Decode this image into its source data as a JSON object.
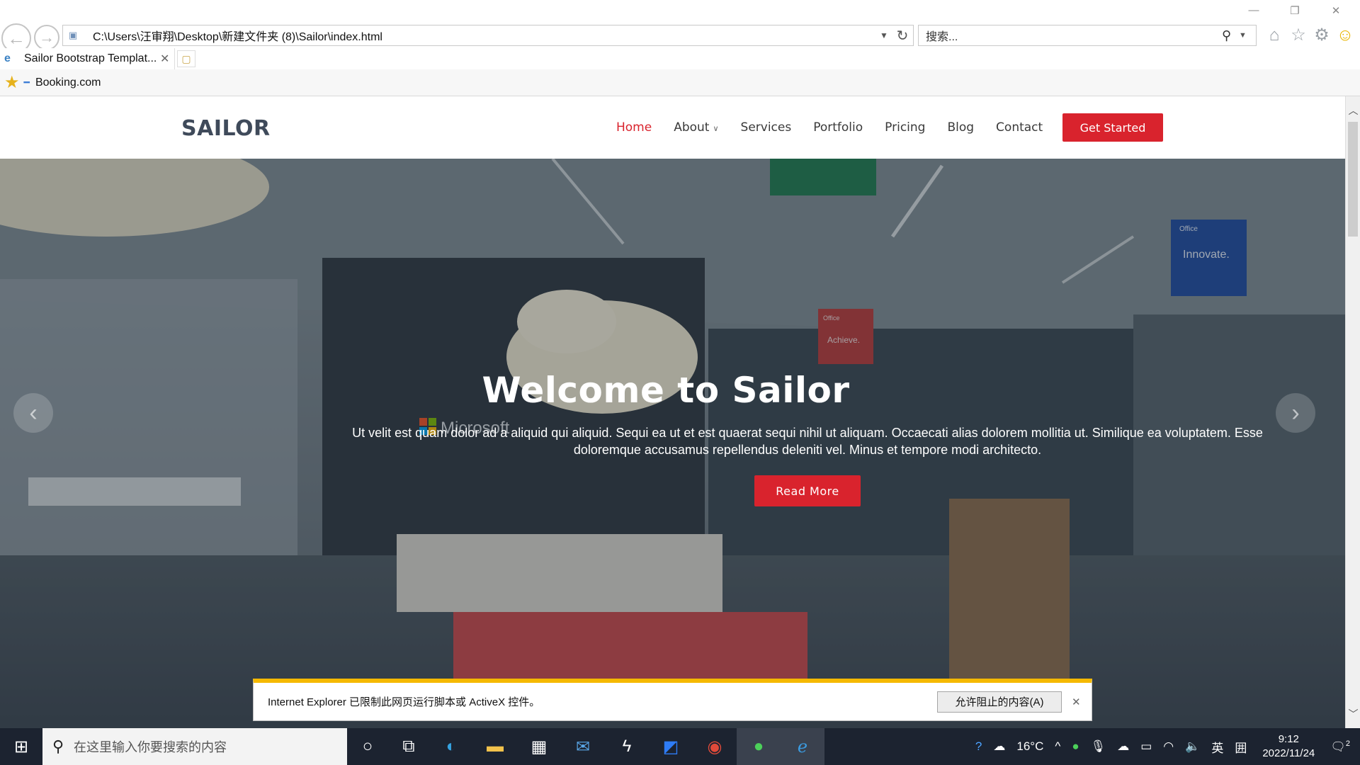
{
  "browser": {
    "address": "C:\\Users\\汪审翔\\Desktop\\新建文件夹 (8)\\Sailor\\index.html",
    "search_placeholder": "搜索...",
    "tab_title": "Sailor Bootstrap Templat...",
    "favorite": "Booking.com"
  },
  "site": {
    "logo": "SAILOR",
    "menu": [
      "Home",
      "About",
      "Services",
      "Portfolio",
      "Pricing",
      "Blog",
      "Contact"
    ],
    "cta": "Get Started"
  },
  "hero": {
    "title": "Welcome to Sailor",
    "text": "Ut velit est quam dolor ad a aliquid qui aliquid. Sequi ea ut et est quaerat sequi nihil ut aliquam. Occaecati alias dolorem mollitia ut. Similique ea voluptatem. Esse doloremque accusamus repellendus deleniti vel. Minus et tempore modi architecto.",
    "button": "Read More",
    "signage": [
      "Microsoft",
      "Office",
      "Innovate.",
      "Office",
      "Achieve."
    ]
  },
  "notification": {
    "message": "Internet Explorer 已限制此网页运行脚本或 ActiveX 控件。",
    "allow": "允许阻止的内容(A)"
  },
  "taskbar": {
    "search_placeholder": "在这里输入你要搜索的内容",
    "weather": "16°C",
    "ime": "英",
    "time": "9:12",
    "date": "2022/11/24",
    "notifications": "2"
  }
}
